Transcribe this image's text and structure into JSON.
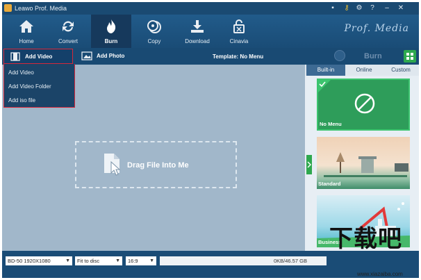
{
  "window": {
    "title": "Leawo Prof. Media"
  },
  "toolbar": {
    "items": [
      {
        "label": "Home",
        "icon": "home-icon"
      },
      {
        "label": "Convert",
        "icon": "convert-icon"
      },
      {
        "label": "Burn",
        "icon": "burn-icon"
      },
      {
        "label": "Copy",
        "icon": "copy-icon"
      },
      {
        "label": "Download",
        "icon": "download-icon"
      },
      {
        "label": "Cinavia",
        "icon": "cinavia-icon"
      }
    ],
    "active": "Burn",
    "brand": "Prof. Media"
  },
  "subbar": {
    "add_video": "Add Video",
    "add_photo": "Add Photo",
    "template": "Template: No Menu",
    "burn": "Burn"
  },
  "dropdown": {
    "items": [
      "Add Video",
      "Add Video Folder",
      "Add iso file"
    ]
  },
  "dropzone": {
    "label": "Drag File Into Me"
  },
  "panel": {
    "tabs": [
      "Built-in",
      "Online",
      "Custom"
    ],
    "active_tab": "Built-in",
    "templates": [
      {
        "name": "No Menu",
        "selected": true
      },
      {
        "name": "Standard",
        "selected": false
      },
      {
        "name": "Business",
        "selected": false
      }
    ]
  },
  "bottom": {
    "disc": "BD-50 1920X1080",
    "fit": "Fit to disc",
    "aspect": "16:9",
    "capacity": "0KB/46.57 GB",
    "capacity_fraction": 0
  },
  "watermark": {
    "big": "下载吧",
    "small": "www.xiazaiba.com"
  },
  "colors": {
    "accent_green": "#2ea84e",
    "highlight_red": "#d6283a",
    "toolbar": "#1b4f7a"
  }
}
